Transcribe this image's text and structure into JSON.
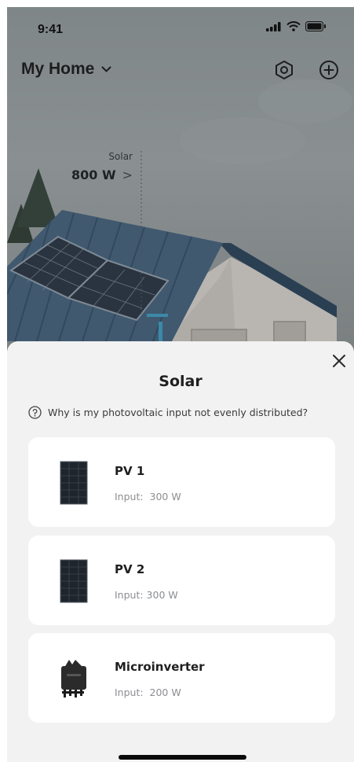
{
  "status_bar": {
    "time": "9:41",
    "icons": [
      "cellular-signal-icon",
      "wifi-icon",
      "battery-icon"
    ]
  },
  "header": {
    "title": "My Home",
    "title_chevron_icon": "chevron-down-icon",
    "actions": [
      "settings-hexagon-icon",
      "add-circle-icon"
    ]
  },
  "scene": {
    "solar_label": "Solar",
    "solar_power": "800 W",
    "solar_chevron": ">"
  },
  "sheet": {
    "title": "Solar",
    "close_icon": "close-icon",
    "help_icon": "question-circle-icon",
    "help_text": "Why is my photovoltaic input not evenly distributed?",
    "devices": [
      {
        "name": "PV 1",
        "input": "Input:  300 W",
        "icon": "solar-panel-icon"
      },
      {
        "name": "PV 2",
        "input": "Input: 300 W",
        "icon": "solar-panel-icon"
      },
      {
        "name": "Microinverter",
        "input": "Input:  200 W",
        "icon": "microinverter-icon"
      }
    ]
  },
  "colors": {
    "sheet_background": "#f2f2f3",
    "card_background": "#ffffff",
    "text_primary": "#1f1f1f",
    "text_secondary": "#8b8d91",
    "roof": "#3f5a73"
  }
}
